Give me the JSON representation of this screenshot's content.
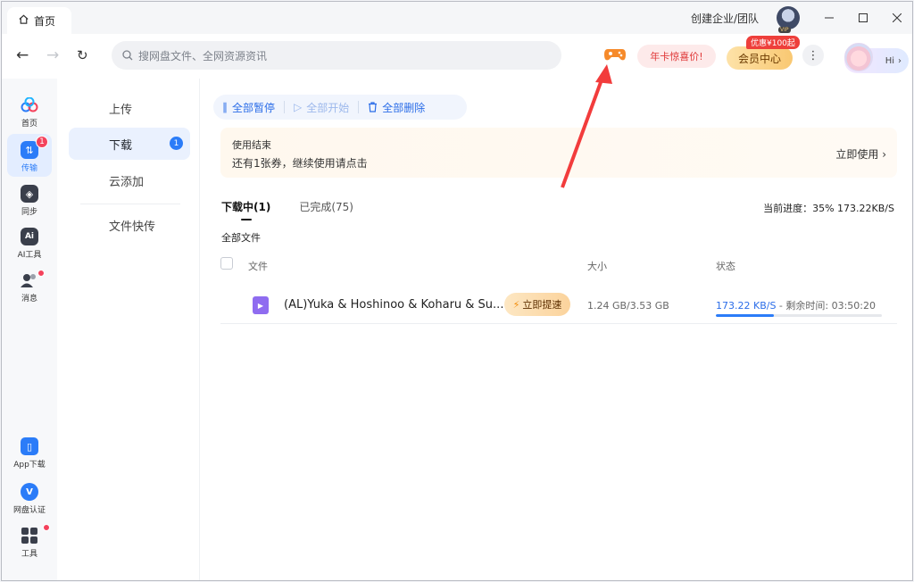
{
  "window": {
    "tab_label": "首页",
    "corp_label": "创建企业/团队",
    "avatar_vip": "VIP"
  },
  "toolbar": {
    "search_placeholder": "搜网盘文件、全网资源资讯",
    "promo_label": "年卡惊喜价!",
    "vip_center_label": "会员中心",
    "vip_badge": "优惠¥100起",
    "hi_label": "Hi"
  },
  "rail": {
    "items": [
      {
        "label": "首页",
        "icon": "home-cloud-icon"
      },
      {
        "label": "传输",
        "icon": "transfer-icon",
        "badge": "1"
      },
      {
        "label": "同步",
        "icon": "sync-icon"
      },
      {
        "label": "AI工具",
        "icon": "ai-tools-icon"
      },
      {
        "label": "消息",
        "icon": "messages-icon"
      },
      {
        "label": "App下载",
        "icon": "phone-icon"
      },
      {
        "label": "网盘认证",
        "icon": "verify-icon"
      },
      {
        "label": "工具",
        "icon": "tools-grid-icon"
      }
    ],
    "colors": {
      "accent": "#2b7cf8",
      "badge": "#f4425c"
    }
  },
  "subnav": {
    "items": [
      {
        "label": "上传"
      },
      {
        "label": "下载",
        "badge": "1"
      },
      {
        "label": "云添加"
      },
      {
        "label": "文件快传"
      }
    ]
  },
  "main": {
    "actions": {
      "pause_all": "全部暂停",
      "start_all": "全部开始",
      "delete_all": "全部删除"
    },
    "notice": {
      "title": "使用结束",
      "body": "还有1张券，继续使用请点击",
      "link": "立即使用"
    },
    "tabs": [
      {
        "label": "下载中(1)"
      },
      {
        "label": "已完成(75)"
      }
    ],
    "progress_summary": "当前进度：35%   173.22KB/S",
    "all_files": "全部文件",
    "columns": {
      "file": "文件",
      "size": "大小",
      "status": "状态"
    },
    "rows": [
      {
        "name": "(AL)Yuka & Hoshinoo & Koharu & Su...",
        "boost_label": "立即提速",
        "size": "1.24 GB/3.53 GB",
        "speed": "173.22 KB/S",
        "remaining": " - 剩余时间: 03:50:20",
        "progress": 0.35
      }
    ]
  }
}
